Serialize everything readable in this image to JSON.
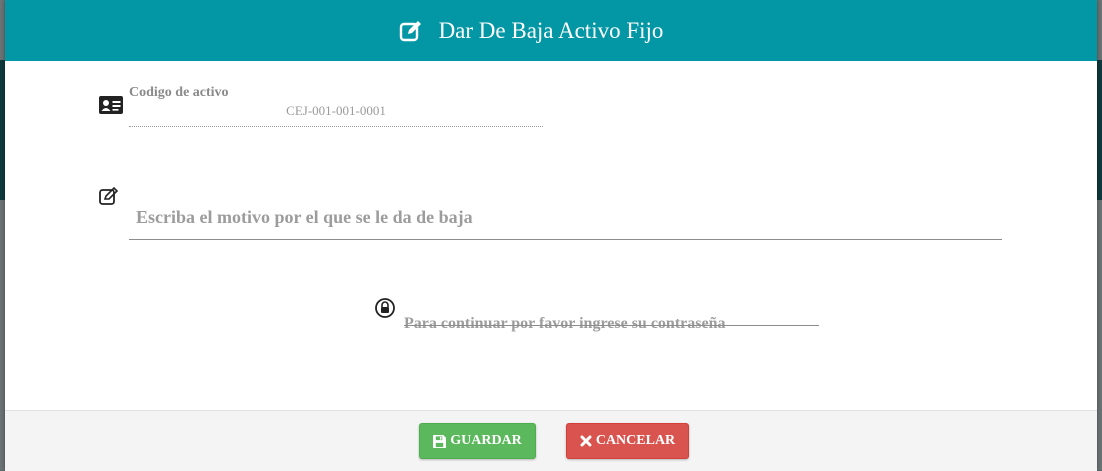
{
  "modal": {
    "title": "Dar De Baja Activo Fijo",
    "title_icon": "edit-icon",
    "header_color": "#0397a6"
  },
  "form": {
    "codigo": {
      "icon": "id-card-icon",
      "label": "Codigo de activo",
      "value": "CEJ-001-001-0001"
    },
    "motivo": {
      "icon": "edit-icon",
      "placeholder": "Escriba el motivo por el que se le da de baja",
      "value": ""
    },
    "password": {
      "icon": "lock-icon",
      "placeholder": "Para continuar por favor ingrese su contraseña",
      "value": ""
    }
  },
  "footer": {
    "save_label": "GUARDAR",
    "save_icon": "floppy-disk-icon",
    "save_color": "#5cb85c",
    "cancel_label": "CANCELAR",
    "cancel_icon": "close-icon",
    "cancel_color": "#d9534f"
  }
}
